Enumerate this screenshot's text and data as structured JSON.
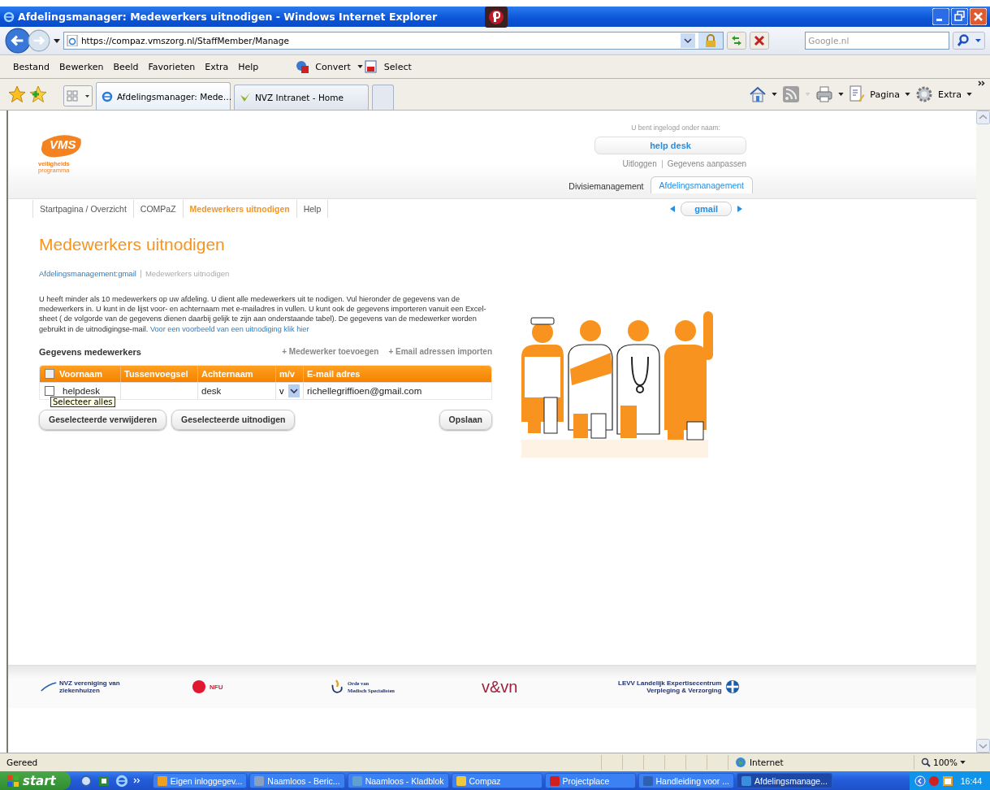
{
  "window": {
    "title": "Afdelingsmanager: Medewerkers uitnodigen - Windows Internet Explorer"
  },
  "address_bar": {
    "url": "https://compaz.vmszorg.nl/StaffMember/Manage",
    "search_placeholder": "Google.nl"
  },
  "menu": [
    "Bestand",
    "Bewerken",
    "Beeld",
    "Favorieten",
    "Extra",
    "Help"
  ],
  "addons": [
    "Convert",
    "Select"
  ],
  "browser_tabs": [
    {
      "label": "Afdelingsmanager: Mede…",
      "selected": true
    },
    {
      "label": "NVZ Intranet - Home",
      "selected": false
    }
  ],
  "command_bar": [
    "Pagina",
    "Extra"
  ],
  "logo": {
    "mark": "VMS",
    "line1": "veiligheids",
    "line2": "programma"
  },
  "login": {
    "label": "U bent ingelogd onder naam:",
    "user": "help desk",
    "links": [
      "Uitloggen",
      "Gegevens aanpassen"
    ]
  },
  "section_tabs": [
    {
      "label": "Divisiemanagement",
      "selected": false
    },
    {
      "label": "Afdelingsmanagement",
      "selected": true
    }
  ],
  "nav": [
    {
      "label": "Startpagina / Overzicht",
      "selected": false
    },
    {
      "label": "COMPaZ",
      "selected": false
    },
    {
      "label": "Medewerkers uitnodigen",
      "selected": true
    },
    {
      "label": "Help",
      "selected": false
    }
  ],
  "department": "gmail",
  "content": {
    "title": "Medewerkers uitnodigen",
    "breadcrumb": [
      {
        "label": "Afdelingsmanagement:gmail",
        "kind": "link"
      },
      {
        "label": "Medewerkers uitnodigen",
        "kind": "current"
      }
    ],
    "intro": "U heeft minder als 10 medewerkers op uw afdeling. U dient alle medewerkers uit te nodigen. Vul hieronder de gegevens van de medewerkers in. U kunt in de lijst voor- en achternaam met e-mailadres in vullen. U kunt ook de gegevens importeren vanuit een Excel-sheet ( de volgorde van de gegevens dienen daarbij gelijk te zijn aan onderstaande tabel). De gegevens van de medewerker worden gebruikt in de uitnodigingse-mail.",
    "intro_link": "Voor een voorbeeld van een uitnodiging klik hier",
    "section_title": "Gegevens medewerkers",
    "actions": [
      "+ Medewerker toevoegen",
      "+ Email adressen importen"
    ],
    "table": {
      "select_all_checked": false,
      "columns": [
        "Voornaam",
        "Tussenvoegsel",
        "Achternaam",
        "m/v",
        "E-mail adres"
      ],
      "rows": [
        {
          "checked": false,
          "first_name": "helpdesk",
          "last_name": "desk",
          "gender": "v",
          "email": "richellegriffioen@gmail.com"
        }
      ]
    },
    "tooltip": "Selecteer alles",
    "buttons": [
      "Geselecteerde verwijderen",
      "Geselecteerde uitnodigen",
      "Opslaan"
    ]
  },
  "footer_logos": [
    {
      "kind": "nvz",
      "lines": [
        "NVZ vereniging van",
        "ziekenhuizen"
      ]
    },
    {
      "kind": "nfu",
      "lines": [
        "NFU"
      ]
    },
    {
      "kind": "orde",
      "lines": [
        "Orde van",
        "Medisch Specialisten"
      ]
    },
    {
      "kind": "vvn",
      "lines": [
        "v&vn"
      ]
    },
    {
      "kind": "levv",
      "lines": [
        "LEVV Landelijk Expertisecentrum",
        "Verpleging & Verzorging"
      ]
    }
  ],
  "status_bar": {
    "text": "Gereed",
    "zone": "Internet",
    "zoom": "100%"
  },
  "taskbar": {
    "start": "start",
    "items": [
      {
        "label": "Eigen inloggegev...",
        "kind": "outlook",
        "selected": false
      },
      {
        "label": "Naamloos - Beric...",
        "kind": "mail",
        "selected": false
      },
      {
        "label": "Naamloos - Kladblok",
        "kind": "notepad",
        "selected": false
      },
      {
        "label": "Compaz",
        "kind": "folder",
        "selected": false
      },
      {
        "label": "Projectplace",
        "kind": "projectplace",
        "selected": false
      },
      {
        "label": "Handleiding voor ...",
        "kind": "word",
        "selected": false
      },
      {
        "label": "Afdelingsmanage...",
        "kind": "ie",
        "selected": true
      }
    ],
    "clock": "16:44"
  }
}
